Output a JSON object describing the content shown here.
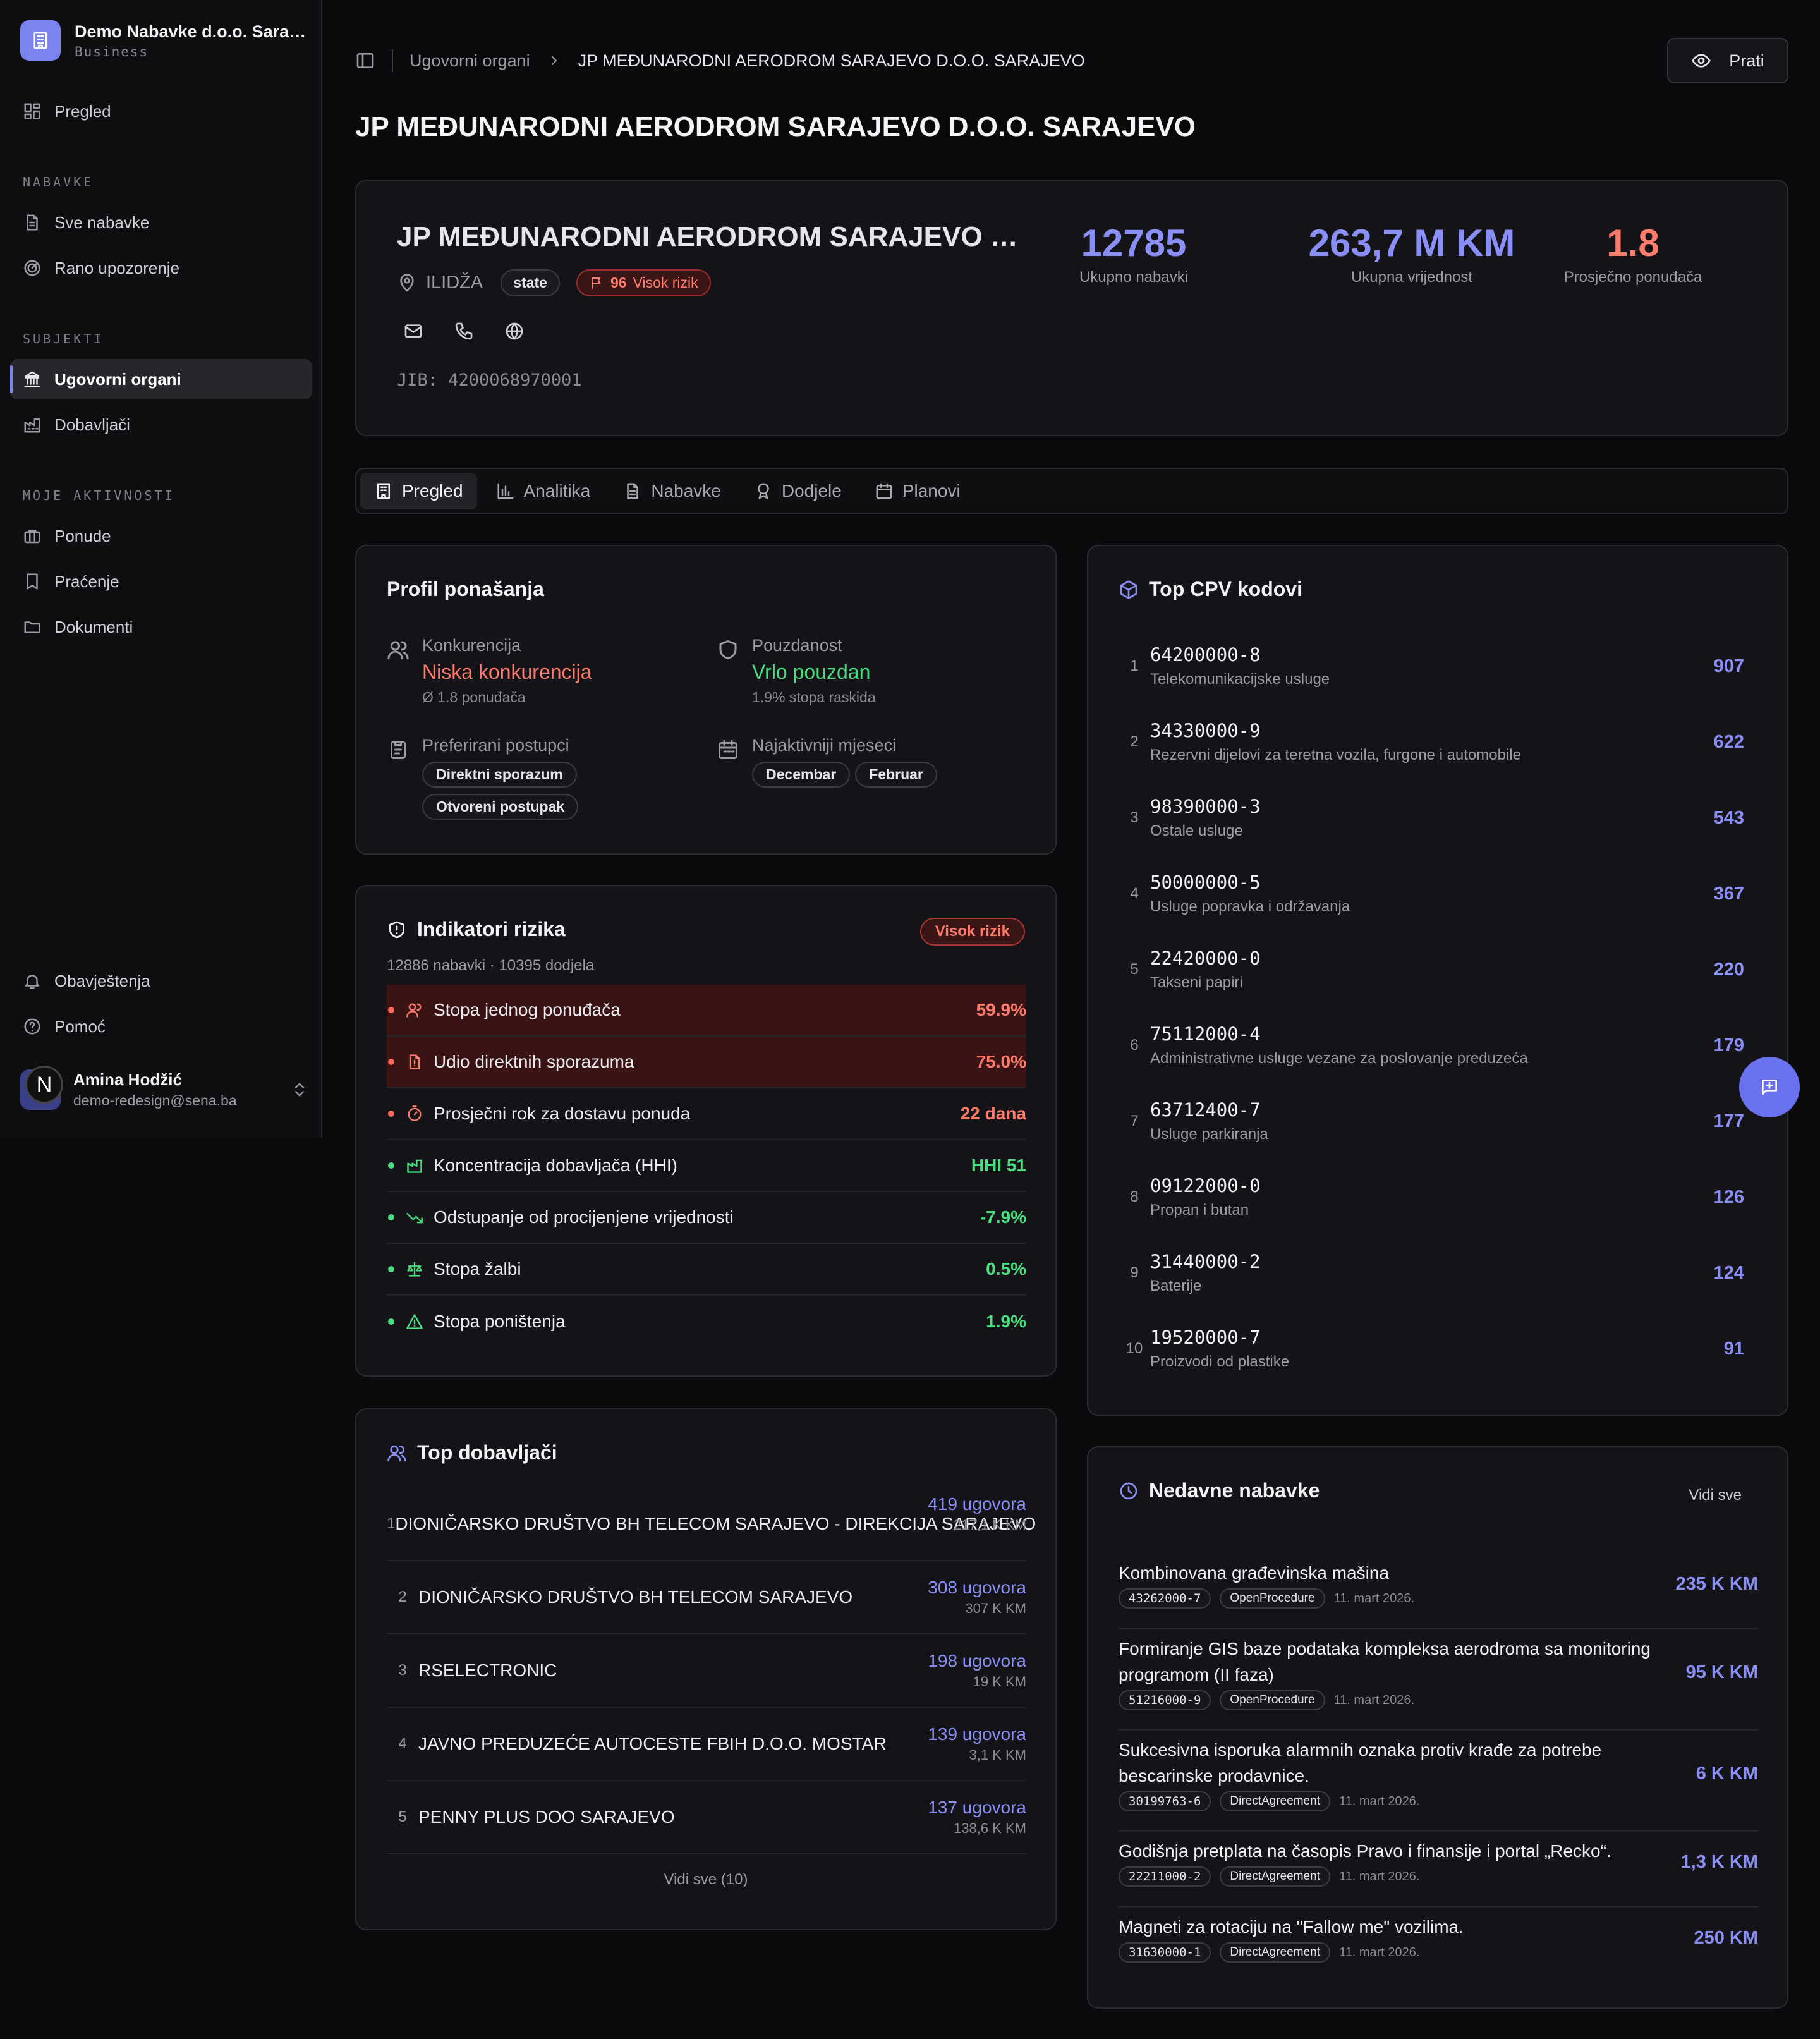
{
  "sidebar": {
    "org_name": "Demo Nabavke d.o.o. Sarajevo",
    "org_plan": "Business",
    "overview": "Pregled",
    "section_procurement": "NABAVKE",
    "all_procurements": "Sve nabavke",
    "early_warning": "Rano upozorenje",
    "section_subjects": "SUBJEKTI",
    "contracting_authorities": "Ugovorni organi",
    "suppliers": "Dobavljači",
    "section_activities": "MOJE AKTIVNOSTI",
    "offers": "Ponude",
    "tracking": "Praćenje",
    "documents": "Dokumenti",
    "notifications": "Obavještenja",
    "help": "Pomoć",
    "user_initial": "N",
    "user_name": "Amina Hodžić",
    "user_email": "demo-redesign@sena.ba"
  },
  "header": {
    "breadcrumb_root": "Ugovorni organi",
    "breadcrumb_current": "JP MEĐUNARODNI AERODROM SARAJEVO D.O.O. SARAJEVO",
    "follow_label": "Prati",
    "page_title": "JP MEĐUNARODNI AERODROM SARAJEVO D.O.O. SARAJEVO"
  },
  "hero": {
    "name": "JP MEĐUNARODNI AERODROM SARAJEVO D.O.O. SARAJEVO",
    "location": "ILIDŽA",
    "type": "state",
    "risk_score": "96",
    "risk_label": "Visok rizik",
    "jib": "JIB: 4200068970001",
    "stats": [
      {
        "value": "12785",
        "label": "Ukupno nabavki",
        "color": "#8a8ff7"
      },
      {
        "value": "263,7 M KM",
        "label": "Ukupna vrijednost",
        "color": "#8a8ff7"
      },
      {
        "value": "1.8",
        "label": "Prosječno ponuđača",
        "color": "#ff7b6b"
      }
    ]
  },
  "tabs": [
    "Pregled",
    "Analitika",
    "Nabavke",
    "Dodjele",
    "Planovi"
  ],
  "behavior": {
    "title": "Profil ponašanja",
    "competition_label": "Konkurencija",
    "competition_value": "Niska konkurencija",
    "competition_sub": "Ø 1.8 ponuđača",
    "reliability_label": "Pouzdanost",
    "reliability_value": "Vrlo pouzdan",
    "reliability_sub": "1.9% stopa raskida",
    "procedures_label": "Preferirani postupci",
    "procedures": [
      "Direktni sporazum",
      "Otvoreni postupak"
    ],
    "months_label": "Najaktivniji mjeseci",
    "months": [
      "Decembar",
      "Februar"
    ]
  },
  "risk": {
    "title": "Indikatori rizika",
    "badge": "Visok rizik",
    "subtitle": "12886 nabavki · 10395 dodjela",
    "rows": [
      {
        "label": "Stopa jednog ponuđača",
        "value": "59.9%",
        "level": "high"
      },
      {
        "label": "Udio direktnih sporazuma",
        "value": "75.0%",
        "level": "high"
      },
      {
        "label": "Prosječni rok za dostavu ponuda",
        "value": "22 dana",
        "level": "medium"
      },
      {
        "label": "Koncentracija dobavljača (HHI)",
        "value": "HHI 51",
        "level": "low"
      },
      {
        "label": "Odstupanje od procijenjene vrijednosti",
        "value": "-7.9%",
        "level": "low"
      },
      {
        "label": "Stopa žalbi",
        "value": "0.5%",
        "level": "low"
      },
      {
        "label": "Stopa poništenja",
        "value": "1.9%",
        "level": "low"
      }
    ]
  },
  "suppliers": {
    "title": "Top dobavljači",
    "view_all": "Vidi sve (10)",
    "rows": [
      {
        "rank": "1",
        "name": "DIONIČARSKO DRUŠTVO BH TELECOM SARAJEVO - DIREKCIJA SARAJEVO",
        "contracts": "419 ugovora",
        "amount": "217,1 K KM"
      },
      {
        "rank": "2",
        "name": "DIONIČARSKO DRUŠTVO BH TELECOM SARAJEVO",
        "contracts": "308 ugovora",
        "amount": "307 K KM"
      },
      {
        "rank": "3",
        "name": "RSELECTRONIC",
        "contracts": "198 ugovora",
        "amount": "19 K KM"
      },
      {
        "rank": "4",
        "name": "JAVNO PREDUZEĆE AUTOCESTE FBIH D.O.O. MOSTAR",
        "contracts": "139 ugovora",
        "amount": "3,1 K KM"
      },
      {
        "rank": "5",
        "name": "PENNY PLUS DOO SARAJEVO",
        "contracts": "137 ugovora",
        "amount": "138,6 K KM"
      }
    ]
  },
  "cpv": {
    "title": "Top CPV kodovi",
    "rows": [
      {
        "rank": "1",
        "code": "64200000-8",
        "desc": "Telekomunikacijske usluge",
        "count": "907"
      },
      {
        "rank": "2",
        "code": "34330000-9",
        "desc": "Rezervni dijelovi za teretna vozila, furgone i automobile",
        "count": "622"
      },
      {
        "rank": "3",
        "code": "98390000-3",
        "desc": "Ostale usluge",
        "count": "543"
      },
      {
        "rank": "4",
        "code": "50000000-5",
        "desc": "Usluge popravka i održavanja",
        "count": "367"
      },
      {
        "rank": "5",
        "code": "22420000-0",
        "desc": "Takseni papiri",
        "count": "220"
      },
      {
        "rank": "6",
        "code": "75112000-4",
        "desc": "Administrativne usluge vezane za poslovanje preduzeća",
        "count": "179"
      },
      {
        "rank": "7",
        "code": "63712400-7",
        "desc": "Usluge parkiranja",
        "count": "177"
      },
      {
        "rank": "8",
        "code": "09122000-0",
        "desc": "Propan i butan",
        "count": "126"
      },
      {
        "rank": "9",
        "code": "31440000-2",
        "desc": "Baterije",
        "count": "124"
      },
      {
        "rank": "10",
        "code": "19520000-7",
        "desc": "Proizvodi od plastike",
        "count": "91"
      }
    ]
  },
  "recent": {
    "title": "Nedavne nabavke",
    "view_all": "Vidi sve",
    "rows": [
      {
        "title": "Kombinovana građevinska mašina",
        "cpv": "43262000-7",
        "procedure": "OpenProcedure",
        "date": "11. mart 2026.",
        "value": "235 K KM"
      },
      {
        "title": "Formiranje GIS baze podataka kompleksa aerodroma sa monitoring programom (II faza)",
        "cpv": "51216000-9",
        "procedure": "OpenProcedure",
        "date": "11. mart 2026.",
        "value": "95 K KM"
      },
      {
        "title": "Sukcesivna isporuka alarmnih oznaka protiv krađe za potrebe bescarinske prodavnice.",
        "cpv": "30199763-6",
        "procedure": "DirectAgreement",
        "date": "11. mart 2026.",
        "value": "6 K KM"
      },
      {
        "title": "Godišnja pretplata na časopis Pravo i finansije i portal „Recko“.",
        "cpv": "22211000-2",
        "procedure": "DirectAgreement",
        "date": "11. mart 2026.",
        "value": "1,3 K KM"
      },
      {
        "title": "Magneti za rotaciju na \"Fallow me\" vozilima.",
        "cpv": "31630000-1",
        "procedure": "DirectAgreement",
        "date": "11. mart 2026.",
        "value": "250 KM"
      }
    ]
  },
  "colors": {
    "accent": "#8a8ff7",
    "danger": "#ff7b6b",
    "success": "#4ade80",
    "danger_bg": "#3a1414"
  }
}
